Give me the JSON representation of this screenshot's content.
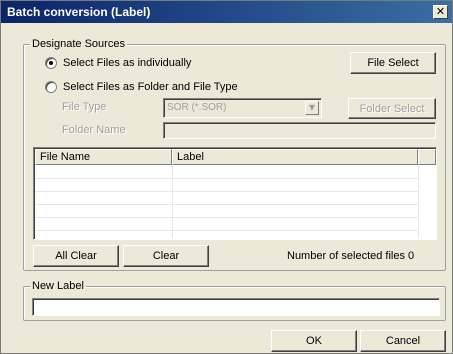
{
  "window": {
    "title": "Batch conversion (Label)",
    "close_glyph": "✕"
  },
  "sources": {
    "legend": "Designate Sources",
    "radio_individual": "Select Files as individually",
    "radio_folder": "Select Files as Folder and File Type",
    "file_select_label": "File Select",
    "file_type_label": "File Type",
    "file_type_value": "SOR (*.SOR)",
    "folder_select_label": "Folder Select",
    "folder_name_label": "Folder Name",
    "folder_name_value": "",
    "selected_mode": "individually"
  },
  "file_list": {
    "columns": [
      "File Name",
      "Label"
    ],
    "rows": [],
    "visible_empty_rows": 6
  },
  "actions": {
    "all_clear_label": "All Clear",
    "clear_label": "Clear",
    "count_label": "Number of selected files 0"
  },
  "new_label": {
    "legend": "New Label",
    "value": ""
  },
  "footer": {
    "ok_label": "OK",
    "cancel_label": "Cancel"
  },
  "icons": {
    "dropdown": "chevron-down-icon",
    "close": "close-icon"
  }
}
